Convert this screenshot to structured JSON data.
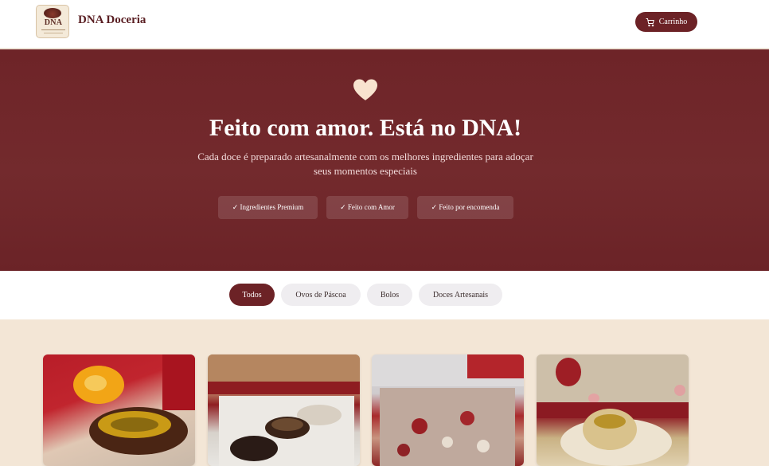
{
  "header": {
    "logo_text": "DNA",
    "brand": "DNA Doceria",
    "cart_label": "Carrinho"
  },
  "hero": {
    "title": "Feito com amor. Está no DNA!",
    "subtitle": "Cada doce é preparado artesanalmente com os melhores ingredientes para adoçar seus momentos especiais",
    "badges": [
      "✓ Ingredientes Premium",
      "✓ Feito com Amor",
      "✓ Feito por encomenda"
    ]
  },
  "filters": {
    "items": [
      "Todos",
      "Ovos de Páscoa",
      "Bolos",
      "Doces Artesanais"
    ],
    "active": "Todos"
  },
  "colors": {
    "brand": "#6c2226",
    "hero_bg": "#6e2428",
    "page_bg": "#f3e6d6"
  },
  "icons": {
    "cart": "cart-icon",
    "heart": "heart-icon"
  }
}
